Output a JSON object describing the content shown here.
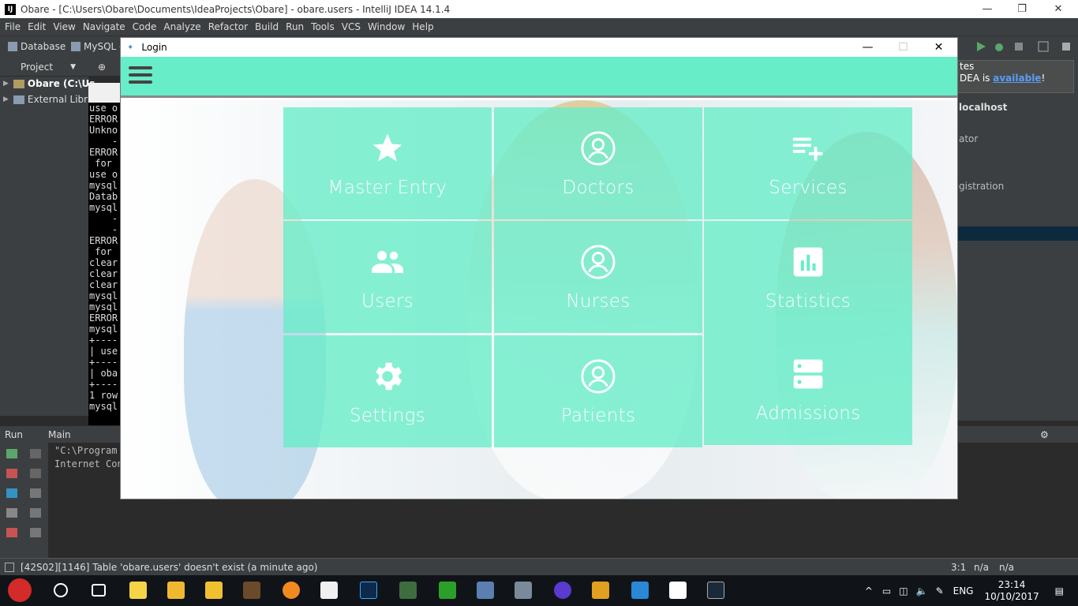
{
  "ide": {
    "title": "Obare - [C:\\Users\\Obare\\Documents\\IdeaProjects\\Obare] - obare.users - IntelliJ IDEA 14.1.4",
    "menu": [
      "File",
      "Edit",
      "View",
      "Navigate",
      "Code",
      "Analyze",
      "Refactor",
      "Build",
      "Run",
      "Tools",
      "VCS",
      "Window",
      "Help"
    ],
    "breadcrumb": [
      "Database",
      "MySQL -"
    ],
    "project_label": "Project",
    "tree": [
      {
        "label": "Obare (C:\\Us"
      },
      {
        "label": "External Libra"
      }
    ],
    "right_panel": {
      "notif_line1": "tes",
      "notif_line2": "DEA is",
      "notif_link": "available",
      "notif_end": "!",
      "host": "localhost",
      "item1": "ator",
      "item2": "gistration"
    },
    "console_lines": [
      "use o",
      "ERROR",
      "Unkno",
      "    -",
      "ERROR",
      " for",
      "use o",
      "mysql",
      "Datab",
      "mysql",
      "    -",
      "    -",
      "",
      "ERROR",
      " for",
      "clear",
      "clear",
      "clear",
      "mysql",
      "mysql",
      "ERROR",
      "mysql",
      "+----",
      "| use",
      "+----",
      "| oba",
      "+----",
      "1 row",
      "",
      "mysql"
    ],
    "run": {
      "tab_run": "Run",
      "tab_main": "Main",
      "output": [
        "\"C:\\Program",
        "Internet Con"
      ]
    },
    "status": {
      "message": "[42S02][1146] Table 'obare.users' doesn't exist (a minute ago)",
      "pos": "3:1",
      "na1": "n/a",
      "na2": "n/a"
    }
  },
  "login": {
    "title": "Login",
    "tiles": [
      {
        "label": "Master Entry",
        "icon": "star-icon"
      },
      {
        "label": "Doctors",
        "icon": "person-circle-icon"
      },
      {
        "label": "Services",
        "icon": "playlist-add-icon"
      },
      {
        "label": "Users",
        "icon": "group-icon"
      },
      {
        "label": "Nurses",
        "icon": "person-circle-icon"
      },
      {
        "label": "Statistics",
        "icon": "bar-chart-icon"
      },
      {
        "label": "Settings",
        "icon": "gear-icon"
      },
      {
        "label": "Patients",
        "icon": "person-circle-icon"
      },
      {
        "label": "Admissions",
        "icon": "server-icon"
      }
    ],
    "accent": "#67edc8"
  },
  "taskbar": {
    "lang": "ENG",
    "time": "23:14",
    "date": "10/10/2017"
  }
}
